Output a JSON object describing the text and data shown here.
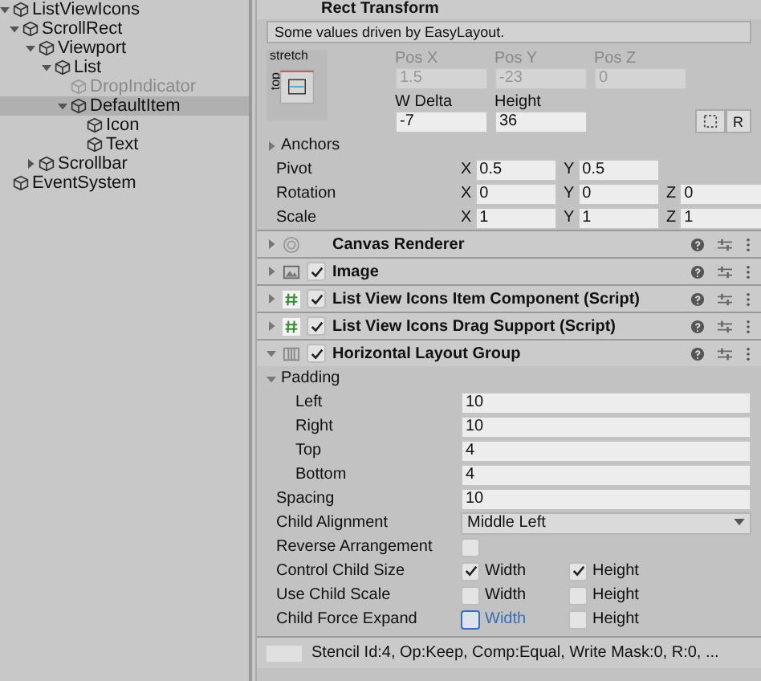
{
  "hierarchy": [
    {
      "label": "ListViewIcons",
      "expanded": true,
      "selected": false,
      "disabled": false,
      "children": [
        {
          "label": "ScrollRect",
          "expanded": true,
          "selected": false,
          "disabled": false,
          "children": [
            {
              "label": "Viewport",
              "expanded": true,
              "selected": false,
              "disabled": false,
              "children": [
                {
                  "label": "List",
                  "expanded": true,
                  "selected": false,
                  "disabled": false,
                  "children": [
                    {
                      "label": "DropIndicator",
                      "selected": false,
                      "disabled": true
                    },
                    {
                      "label": "DefaultItem",
                      "expanded": true,
                      "selected": true,
                      "disabled": false,
                      "children": [
                        {
                          "label": "Icon",
                          "selected": false,
                          "disabled": false
                        },
                        {
                          "label": "Text",
                          "selected": false,
                          "disabled": false
                        }
                      ]
                    }
                  ]
                }
              ]
            },
            {
              "label": "Scrollbar",
              "expanded": false,
              "selected": false,
              "disabled": false
            }
          ]
        }
      ]
    },
    {
      "label": "EventSystem",
      "selected": false,
      "disabled": false
    }
  ],
  "rect_transform": {
    "title": "Rect Transform",
    "note": "Some values driven by EasyLayout.",
    "anchor_h": "stretch",
    "anchor_v": "top",
    "pos": [
      {
        "label": "Pos X",
        "value": "1.5"
      },
      {
        "label": "Pos Y",
        "value": "-23"
      },
      {
        "label": "Pos Z",
        "value": "0"
      }
    ],
    "size": [
      {
        "label": "W Delta",
        "value": "-7"
      },
      {
        "label": "Height",
        "value": "36"
      }
    ],
    "raw_button": "R",
    "anchors": {
      "label": "Anchors",
      "expanded": false
    },
    "vectors": [
      {
        "label": "Pivot",
        "axes": [
          {
            "axis": "X",
            "value": "0.5"
          },
          {
            "axis": "Y",
            "value": "0.5"
          }
        ]
      },
      {
        "label": "Rotation",
        "axes": [
          {
            "axis": "X",
            "value": "0"
          },
          {
            "axis": "Y",
            "value": "0"
          },
          {
            "axis": "Z",
            "value": "0"
          }
        ]
      },
      {
        "label": "Scale",
        "axes": [
          {
            "axis": "X",
            "value": "1"
          },
          {
            "axis": "Y",
            "value": "1"
          },
          {
            "axis": "Z",
            "value": "1"
          }
        ]
      }
    ]
  },
  "components": [
    {
      "title": "Canvas Renderer",
      "kind": "renderer",
      "expanded": false
    },
    {
      "title": "Image",
      "kind": "image",
      "expanded": false,
      "enabled": true
    },
    {
      "title": "List View Icons Item Component (Script)",
      "kind": "script",
      "expanded": false,
      "enabled": true
    },
    {
      "title": "List View Icons Drag Support (Script)",
      "kind": "script",
      "expanded": false,
      "enabled": true
    },
    {
      "title": "Horizontal Layout Group",
      "kind": "layout",
      "expanded": true,
      "enabled": true
    }
  ],
  "layout_group": {
    "padding": {
      "label": "Padding",
      "expanded": true,
      "fields": [
        {
          "label": "Left",
          "value": "10"
        },
        {
          "label": "Right",
          "value": "10"
        },
        {
          "label": "Top",
          "value": "4"
        },
        {
          "label": "Bottom",
          "value": "4"
        }
      ]
    },
    "rows": [
      {
        "kind": "number",
        "label": "Spacing",
        "value": "10"
      },
      {
        "kind": "dropdown",
        "label": "Child Alignment",
        "value": "Middle Left"
      },
      {
        "kind": "toggle",
        "label": "Reverse Arrangement",
        "checked": false
      },
      {
        "kind": "pair",
        "label": "Control Child Size",
        "options": [
          {
            "label": "Width",
            "checked": true,
            "focused": false
          },
          {
            "label": "Height",
            "checked": true,
            "focused": false
          }
        ]
      },
      {
        "kind": "pair",
        "label": "Use Child Scale",
        "options": [
          {
            "label": "Width",
            "checked": false,
            "focused": false
          },
          {
            "label": "Height",
            "checked": false,
            "focused": false
          }
        ]
      },
      {
        "kind": "pair",
        "label": "Child Force Expand",
        "options": [
          {
            "label": "Width",
            "checked": false,
            "focused": true
          },
          {
            "label": "Height",
            "checked": false,
            "focused": false
          }
        ]
      }
    ]
  },
  "stencil": "Stencil Id:4, Op:Keep, Comp:Equal, Write Mask:0, R:0, ..."
}
